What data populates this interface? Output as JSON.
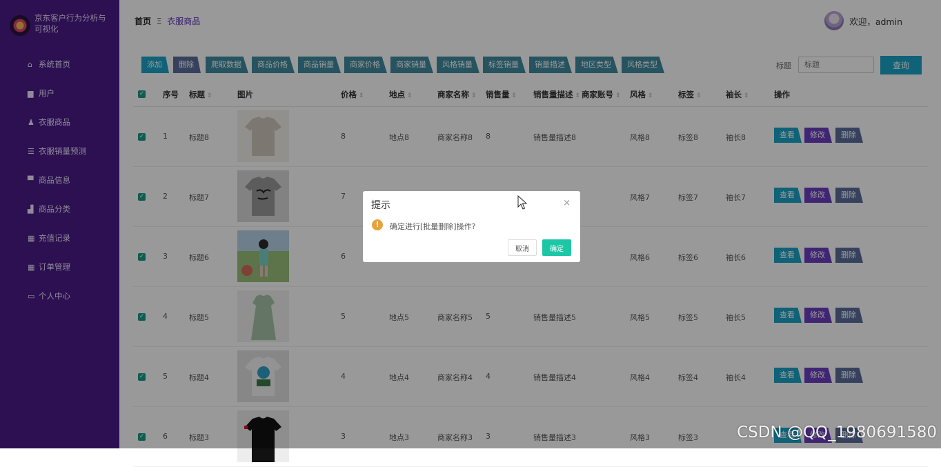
{
  "brand": {
    "title": "京东客户行为分析与可视化"
  },
  "sidebar": {
    "items": [
      {
        "label": "系统首页",
        "icon": "home-icon"
      },
      {
        "label": "用户",
        "icon": "user-doc-icon"
      },
      {
        "label": "衣服商品",
        "icon": "person-icon"
      },
      {
        "label": "衣服销量预测",
        "icon": "list-icon"
      },
      {
        "label": "商品信息",
        "icon": "comment-icon"
      },
      {
        "label": "商品分类",
        "icon": "bar-chart-icon"
      },
      {
        "label": "充值记录",
        "icon": "grid-icon"
      },
      {
        "label": "订单管理",
        "icon": "grid-icon"
      },
      {
        "label": "个人中心",
        "icon": "card-icon"
      }
    ]
  },
  "header": {
    "breadcrumb_home": "首页",
    "breadcrumb_sep": "Ξ",
    "breadcrumb_current": "衣服商品",
    "welcome": "欢迎，admin"
  },
  "toolbar": {
    "buttons": [
      {
        "label": "添加",
        "color": "#1aa3c6"
      },
      {
        "label": "删除",
        "color": "#5a6e9c"
      },
      {
        "label": "爬取数据",
        "color": "#3f8aa0"
      },
      {
        "label": "商品价格",
        "color": "#3f8aa0"
      },
      {
        "label": "商品销量",
        "color": "#3f8aa0"
      },
      {
        "label": "商家价格",
        "color": "#3f8aa0"
      },
      {
        "label": "商家销量",
        "color": "#3f8aa0"
      },
      {
        "label": "风格销量",
        "color": "#3f8aa0"
      },
      {
        "label": "标签销量",
        "color": "#3f8aa0"
      },
      {
        "label": "销量描述",
        "color": "#3f8aa0"
      },
      {
        "label": "地区类型",
        "color": "#3f8aa0"
      },
      {
        "label": "风格类型",
        "color": "#3f8aa0"
      }
    ],
    "search_label": "标题",
    "search_placeholder": "标题",
    "search_button": "查询"
  },
  "table": {
    "columns": [
      "序号",
      "标题",
      "图片",
      "价格",
      "地点",
      "商家名称",
      "销售量",
      "销售量描述",
      "商家账号",
      "风格",
      "标签",
      "袖长",
      "操作"
    ],
    "rows": [
      {
        "no": "1",
        "title": "标题8",
        "price": "8",
        "place": "地点8",
        "shop": "商家名称8",
        "sales": "8",
        "desc": "销售量描述8",
        "style": "风格8",
        "tag": "标签8",
        "sleeve": "袖长8",
        "img": "beige-shirt"
      },
      {
        "no": "2",
        "title": "标题7",
        "price": "7",
        "place": "",
        "shop": "",
        "sales": "",
        "desc": "",
        "style": "风格7",
        "tag": "标签7",
        "sleeve": "袖长7",
        "img": "gray-love-shirt"
      },
      {
        "no": "3",
        "title": "标题6",
        "price": "6",
        "place": "",
        "shop": "",
        "sales": "",
        "desc": "",
        "style": "风格6",
        "tag": "标签6",
        "sleeve": "袖长6",
        "img": "girl-photo"
      },
      {
        "no": "4",
        "title": "标题5",
        "price": "5",
        "place": "地点5",
        "shop": "商家名称5",
        "sales": "5",
        "desc": "销售量描述5",
        "style": "风格5",
        "tag": "标签5",
        "sleeve": "袖长5",
        "img": "green-dress"
      },
      {
        "no": "5",
        "title": "标题4",
        "price": "4",
        "place": "地点4",
        "shop": "商家名称4",
        "sales": "4",
        "desc": "销售量描述4",
        "style": "风格4",
        "tag": "标签4",
        "sleeve": "袖长4",
        "img": "cartoon-shirt"
      },
      {
        "no": "6",
        "title": "标题3",
        "price": "3",
        "place": "地点3",
        "shop": "商家名称3",
        "sales": "3",
        "desc": "销售量描述3",
        "style": "风格3",
        "tag": "标签3",
        "sleeve": "",
        "img": "black-shirt"
      }
    ],
    "actions": {
      "view": "查看",
      "edit": "修改",
      "delete": "删除"
    },
    "action_colors": {
      "view": "#1aa3c6",
      "edit": "#6c3fc4",
      "delete": "#5a6e9c"
    }
  },
  "dialog": {
    "title": "提示",
    "close": "×",
    "warn": "!",
    "message": "确定进行[批量删除]操作?",
    "cancel": "取消",
    "confirm": "确定"
  },
  "watermark": "CSDN @QQ_1980691580"
}
